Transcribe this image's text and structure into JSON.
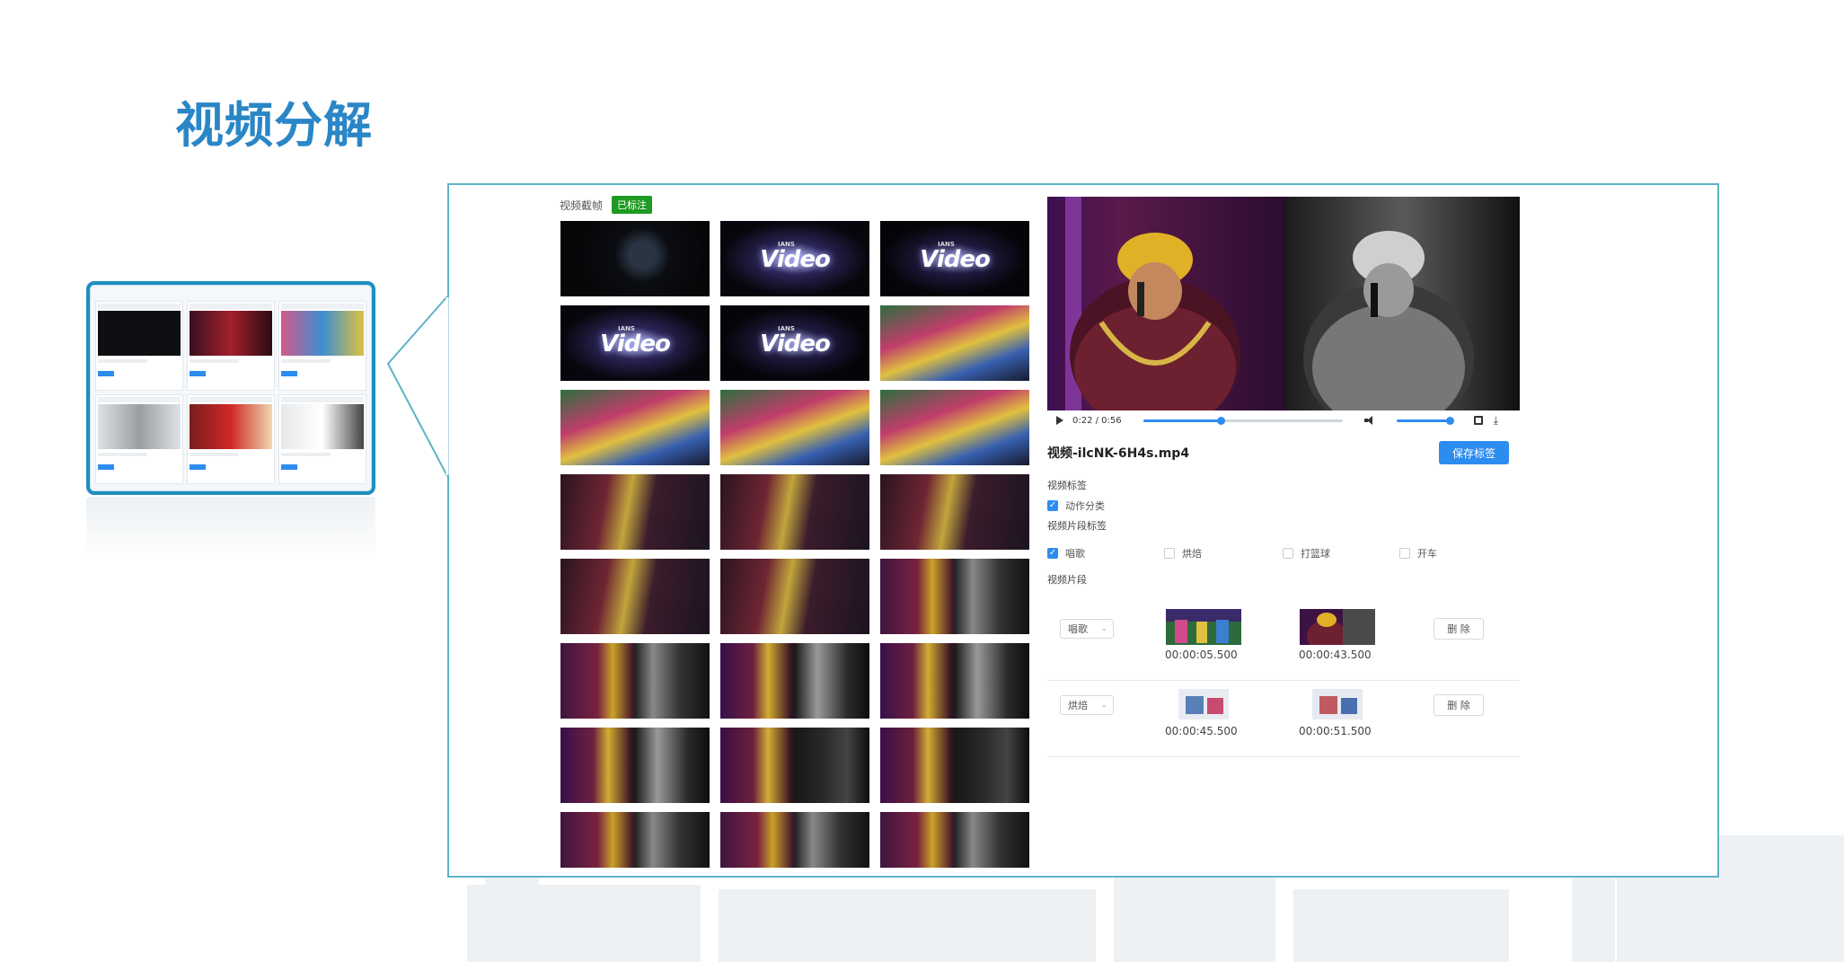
{
  "slide": {
    "title": "视频分解"
  },
  "frames": {
    "label": "视频截帧",
    "status_tag": "已标注",
    "logo_text": "Video",
    "logo_small": "IANS",
    "cells": [
      "dark",
      "logo",
      "logo2",
      "logo",
      "logo2",
      "stage",
      "stage",
      "stage",
      "stage",
      "singer",
      "singer",
      "singer",
      "singer",
      "singer",
      "split",
      "split",
      "split2",
      "split2",
      "split2",
      "split3",
      "split3",
      "split",
      "split",
      "split"
    ]
  },
  "player": {
    "time_display": "0:22 / 0:56",
    "progress": 0.39,
    "volume": 0.95
  },
  "file": {
    "name": "视频-ilcNK-6H4s.mp4",
    "save_label": "保存标签"
  },
  "video_tags": {
    "label": "视频标签",
    "items": [
      {
        "label": "动作分类",
        "checked": true
      }
    ]
  },
  "segment_tags": {
    "label": "视频片段标签",
    "items": [
      {
        "label": "唱歌",
        "checked": true
      },
      {
        "label": "烘焙",
        "checked": false
      },
      {
        "label": "打篮球",
        "checked": false
      },
      {
        "label": "开车",
        "checked": false
      }
    ]
  },
  "segments": {
    "label": "视频片段",
    "rows": [
      {
        "category": "唱歌",
        "start": "00:00:05.500",
        "end": "00:00:43.500",
        "delete_label": "删 除"
      },
      {
        "category": "烘焙",
        "start": "00:00:45.500",
        "end": "00:00:51.500",
        "delete_label": "删 除"
      }
    ]
  },
  "colors": {
    "accent": "#2d8cf0",
    "title": "#2a86c6",
    "frame_border": "#5fb3c7",
    "tag_green": "#1f9a22"
  }
}
